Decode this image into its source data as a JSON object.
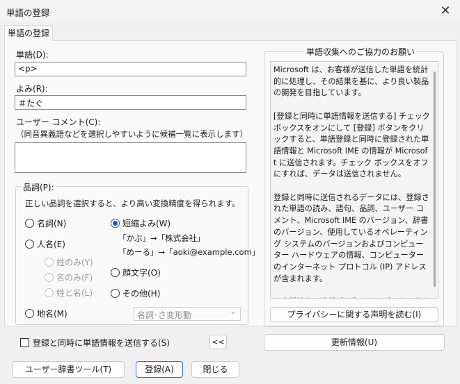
{
  "window": {
    "title": "単語の登録",
    "close_glyph": "✕"
  },
  "tab": {
    "label": "単語の登録"
  },
  "word": {
    "label": "単語(D):",
    "value": "<p>"
  },
  "yomi": {
    "label": "よみ(R):",
    "value": "＃たぐ"
  },
  "comment": {
    "label": "ユーザー コメント(C):",
    "hint": "（同音異義語などを選択しやすいように候補一覧に表示します）",
    "value": ""
  },
  "pos": {
    "legend": "品詞(P):",
    "description": "正しい品詞を選択すると、より高い変換精度を得られます。",
    "noun": "名詞(N)",
    "person": "人名(E)",
    "family_only": "姓のみ(Y)",
    "given_only": "名のみ(F)",
    "family_given": "姓と名(L)",
    "place": "地名(M)",
    "short_reading": "短縮よみ(W)",
    "example1": "「かぶ」→「株式会社」",
    "example2": "「めーる」→「aoki@example.com」",
    "emoticon": "顔文字(O)",
    "other": "その他(H)",
    "other_select_value": "名詞･さ変形動",
    "selected": "short_reading"
  },
  "send_checkbox": {
    "label": "登録と同時に単語情報を送信する(S)",
    "checked": false
  },
  "collapse_button": "<<",
  "info": {
    "title": "単語収集へのご協力のお願い",
    "text": "Microsoft は、お客様が送信した単語を統計的に処理し、その結果を基に、より良い製品の開発を目指しています。\n\n[登録と同時に単語情報を送信する] チェック ボックスをオンにして [登録] ボタンをクリックすると、単語登録と同時に登録された単語情報と Microsoft IME の情報が Microsoft に送信されます。チェック ボックスをオフにすれば、データは送信されません。\n\n登録と同時に送信されるデータには、登録された単語の読み、語句、品詞、ユーザー コメント、Microsoft IME のバージョン、辞書のバージョン、使用しているオペレーティング システムのバージョンおよびコンピューター ハードウェアの情報、コンピューターのインターネット プロトコル (IP) アドレスが含まれます。\n\nお客様特有の情報が収集されたデータに含まれることがあります。このような情報が存在する場合でも、Microsoft では、お客様を特定するために使用することはありません。",
    "privacy_button": "プライバシーに関する声明を読む(I)",
    "update_button": "更新情報(U)"
  },
  "footer": {
    "dict_tool_button": "ユーザー辞書ツール(T)",
    "register_button": "登録(A)",
    "close_button": "閉じる"
  }
}
